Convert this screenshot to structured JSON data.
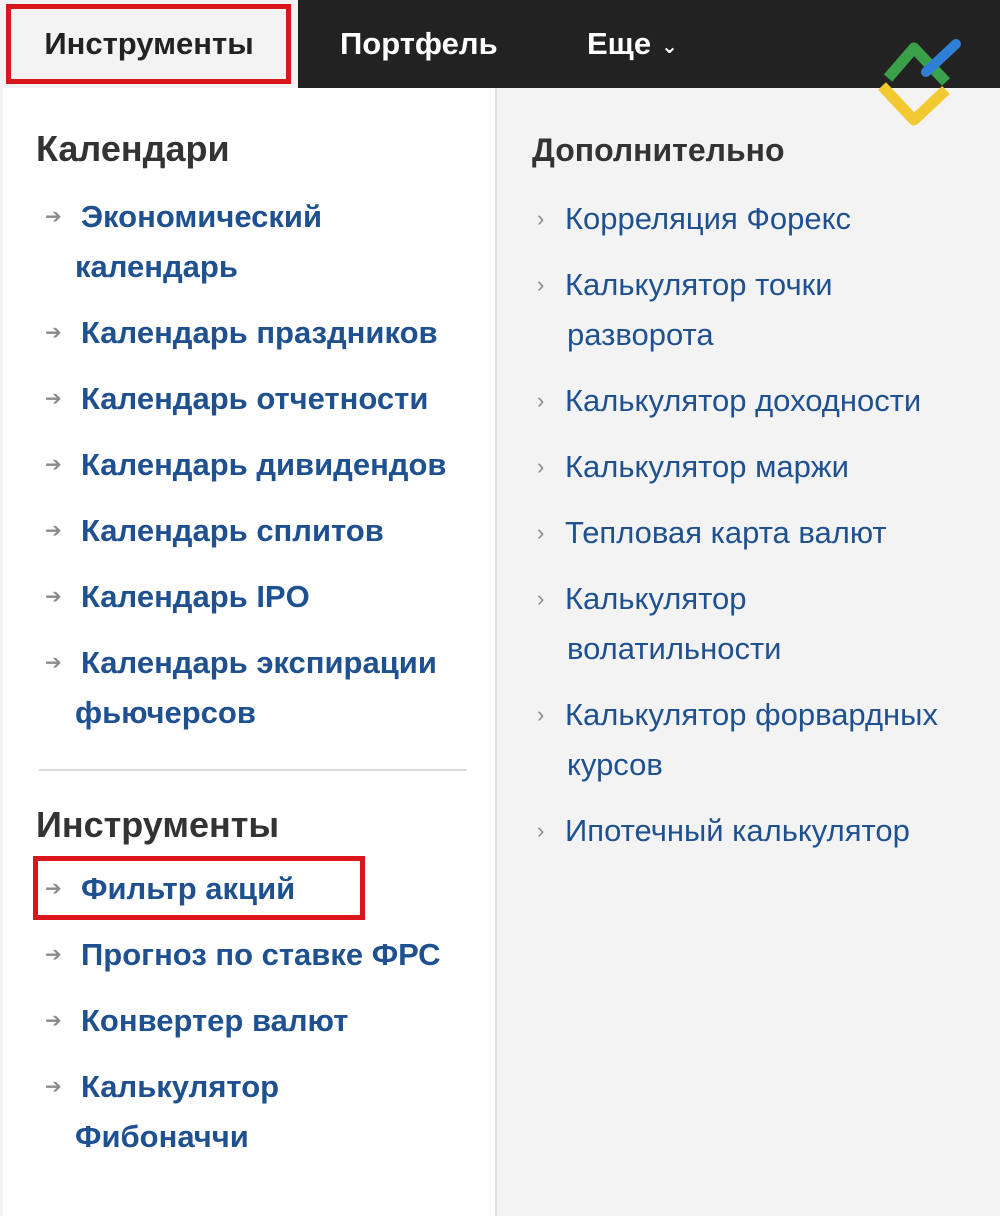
{
  "nav": {
    "tabs": [
      {
        "label": "Инструменты",
        "active": true
      },
      {
        "label": "Портфель"
      },
      {
        "label": "Еще"
      }
    ],
    "more_chevron": "⌄"
  },
  "colors": {
    "topbar": "#222222",
    "link": "#1f5190",
    "highlight": "#d8161c",
    "panel_bg": "#f3f3f3"
  },
  "logo": {
    "icon": "brand-logo-icon"
  },
  "left": {
    "calendars": {
      "title": "Календари",
      "items": [
        {
          "line1": "Экономический",
          "line2": "календарь"
        },
        {
          "line1": "Календарь праздников"
        },
        {
          "line1": "Календарь отчетности"
        },
        {
          "line1": "Календарь дивидендов"
        },
        {
          "line1": "Календарь сплитов"
        },
        {
          "line1": "Календарь IPO"
        },
        {
          "line1": "Календарь экспирации",
          "line2": "фьючерсов"
        }
      ]
    },
    "tools": {
      "title": "Инструменты",
      "items": [
        {
          "line1": "Фильтр акций",
          "highlighted": true
        },
        {
          "line1": "Прогноз по ставке ФРС"
        },
        {
          "line1": "Конвертер валют"
        },
        {
          "line1": "Калькулятор",
          "line2": "Фибоначчи"
        }
      ]
    }
  },
  "right": {
    "title": "Дополнительно",
    "items": [
      {
        "line1": "Корреляция Форекс"
      },
      {
        "line1": "Калькулятор точки",
        "line2": "разворота"
      },
      {
        "line1": "Калькулятор доходности"
      },
      {
        "line1": "Калькулятор маржи"
      },
      {
        "line1": "Тепловая карта валют"
      },
      {
        "line1": "Калькулятор",
        "line2": "волатильности"
      },
      {
        "line1": "Калькулятор форвардных",
        "line2": "курсов"
      },
      {
        "line1": "Ипотечный калькулятор"
      }
    ]
  }
}
